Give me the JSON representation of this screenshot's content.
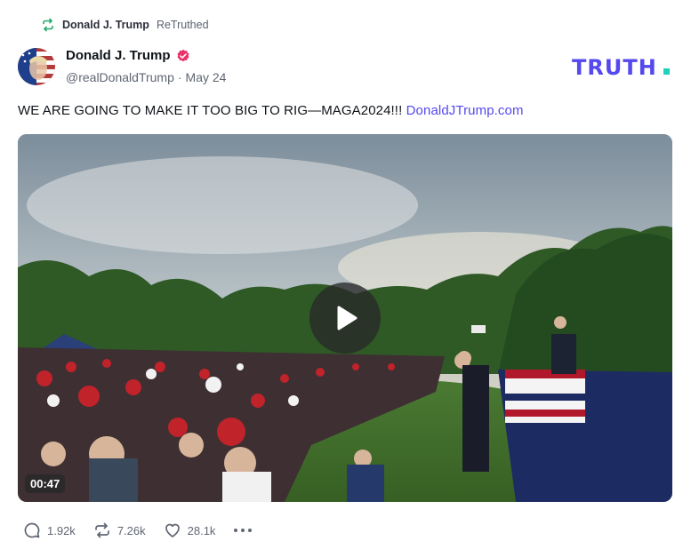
{
  "retruth": {
    "user": "Donald J. Trump",
    "verb": "ReTruthed",
    "icon": "retruth-icon"
  },
  "post": {
    "display_name": "Donald J. Trump",
    "verified_icon": "verified-badge-icon",
    "handle": "@realDonaldTrump",
    "separator": "·",
    "date": "May 24",
    "text": "WE ARE GOING TO MAKE IT TOO BIG TO RIG—MAGA2024!!!",
    "link": "DonaldJTrump.com"
  },
  "brand": {
    "logo_text": "TRUTH.",
    "logo_color": "#5448ee",
    "dot_color": "#1fd1b8"
  },
  "media": {
    "duration": "00:47",
    "play_icon": "play-icon"
  },
  "actions": {
    "replies": "1.92k",
    "retruths": "7.26k",
    "likes": "28.1k"
  },
  "colors": {
    "accent": "#5448ee",
    "retruth_green": "#22a86b",
    "verified_pink": "#e8336b",
    "muted": "#5f6673"
  }
}
